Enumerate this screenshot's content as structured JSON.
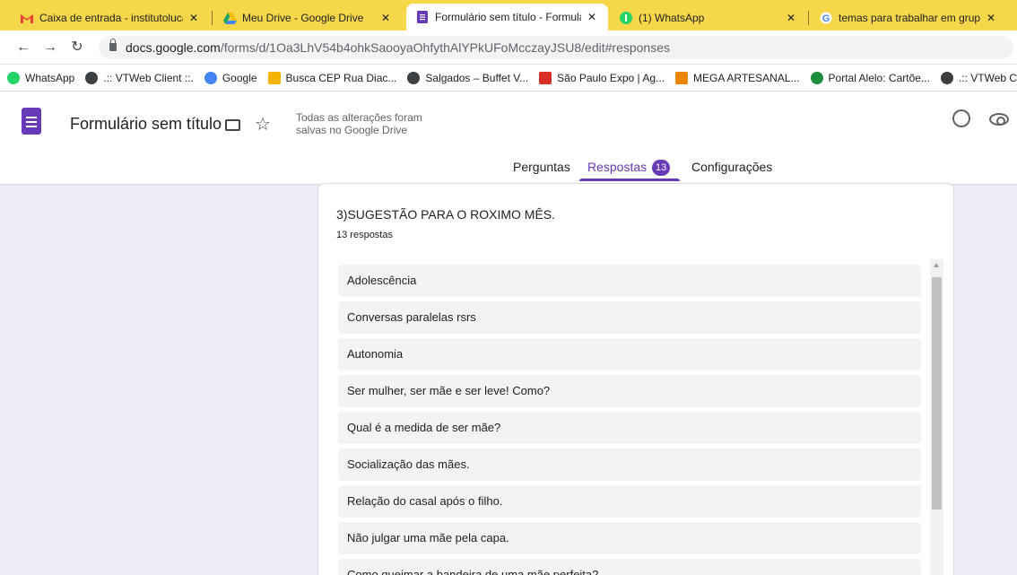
{
  "browser": {
    "tabs": [
      {
        "title": "Caixa de entrada - institutolucas",
        "icon": "gmail-icon"
      },
      {
        "title": "Meu Drive - Google Drive",
        "icon": "google-drive-icon"
      },
      {
        "title": "Formulário sem título - Formulár",
        "icon": "google-forms-icon",
        "active": true
      },
      {
        "title": "(1) WhatsApp",
        "icon": "whatsapp-icon"
      },
      {
        "title": "temas para trabalhar em grupo c",
        "icon": "google-icon"
      }
    ],
    "close_glyph": "✕",
    "url_host": "docs.google.com",
    "url_path": "/forms/d/1Oa3LhV54b4ohkSaooyaOhfythAlYPkUFoMcczayJSU8/edit#responses",
    "bookmarks": [
      {
        "label": "WhatsApp",
        "color": "#25d366"
      },
      {
        "label": ".:: VTWeb Client ::.",
        "color": "#3c4043"
      },
      {
        "label": "Google",
        "color": "#4285f4"
      },
      {
        "label": "Busca CEP Rua Diac...",
        "color": "#f4b400"
      },
      {
        "label": "Salgados – Buffet V...",
        "color": "#3c4043"
      },
      {
        "label": "São Paulo Expo | Ag...",
        "color": "#d93025"
      },
      {
        "label": "MEGA ARTESANAL...",
        "color": "#ea8600"
      },
      {
        "label": "Portal Alelo: Cartõe...",
        "color": "#1e8e3e"
      },
      {
        "label": ".:: VTWeb Client ::.",
        "color": "#3c4043"
      }
    ]
  },
  "form": {
    "title": "Formulário sem título",
    "save_status": "Todas as alterações foram salvas no Google Drive",
    "nav": {
      "questions": "Perguntas",
      "responses": "Respostas",
      "responses_count": "13",
      "settings": "Configurações"
    },
    "accent": "#673ab7",
    "question": {
      "title": "3)SUGESTÃO PARA O ROXIMO MÊS.",
      "count_text": "13 respostas",
      "answers": [
        "Adolescência",
        "Conversas paralelas rsrs",
        "Autonomia",
        "Ser mulher, ser mãe e ser leve! Como?",
        "Qual é a medida de ser mãe?",
        "Socialização das mães.",
        "Relação do casal após o filho.",
        "Não julgar uma mãe pela capa.",
        "Como queimar a bandeira de uma mãe perfeita?"
      ]
    }
  }
}
